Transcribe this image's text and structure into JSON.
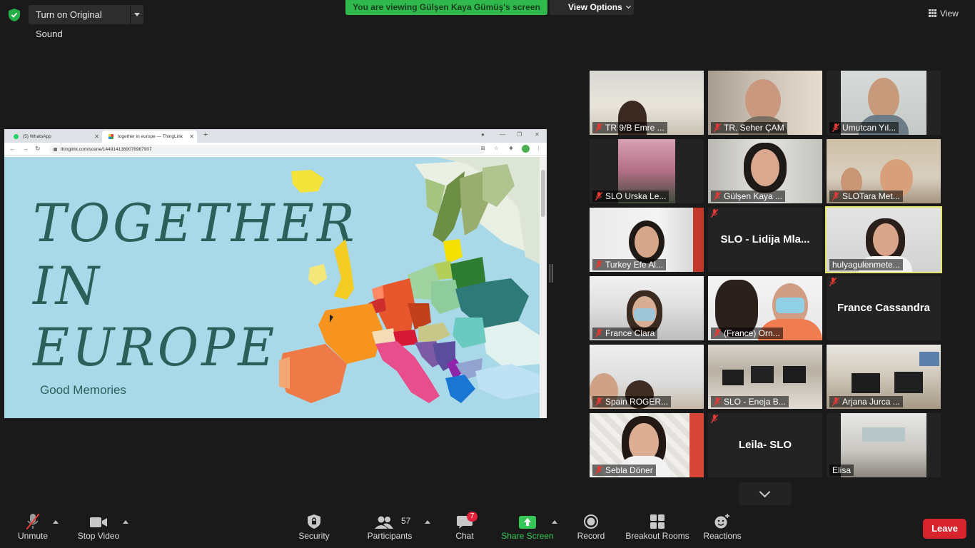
{
  "top": {
    "original_sound_label": "Turn on Original Sound",
    "viewing_banner": "You are viewing Gülşen Kaya Gümüş's screen",
    "view_options_label": "View Options",
    "view_label": "View"
  },
  "shared_screen": {
    "tabs": [
      {
        "label": "(5) WhatsApp"
      },
      {
        "label": "together in europe — ThingLink"
      }
    ],
    "url": "thinglink.com/scene/1449141389076987907",
    "title_lines": [
      "TOGETHER",
      "IN",
      "EUROPE"
    ],
    "subtitle": "Good Memories"
  },
  "participants": [
    {
      "name": "TR 9/B Emre ...",
      "muted": true
    },
    {
      "name": "TR. Seher ÇAM",
      "muted": true
    },
    {
      "name": "Umutcan Yıl...",
      "muted": true
    },
    {
      "name": "SLO Urska Le...",
      "muted": true
    },
    {
      "name": "Gülşen Kaya ...",
      "muted": true
    },
    {
      "name": "SLOTara Met...",
      "muted": true
    },
    {
      "name": "Turkey Efe Al...",
      "muted": true
    },
    {
      "name": "SLO - Lidija Mla...",
      "muted": true
    },
    {
      "name": "hulyagulenmete...",
      "muted": false
    },
    {
      "name": "France Clara",
      "muted": true
    },
    {
      "name": "(France) Orn...",
      "muted": true
    },
    {
      "name": "France Cassandra",
      "muted": true
    },
    {
      "name": "Spain ROGER...",
      "muted": true
    },
    {
      "name": "SLO - Eneja B...",
      "muted": true
    },
    {
      "name": "Arjana Jurca ...",
      "muted": true
    },
    {
      "name": "Sebla Döner",
      "muted": true
    },
    {
      "name": "Leila- SLO",
      "muted": true
    },
    {
      "name": "Elisa",
      "muted": false
    }
  ],
  "toolbar": {
    "unmute": "Unmute",
    "stop_video": "Stop Video",
    "security": "Security",
    "participants": "Participants",
    "participants_count": "57",
    "chat": "Chat",
    "chat_badge": "7",
    "share_screen": "Share Screen",
    "record": "Record",
    "breakout_rooms": "Breakout Rooms",
    "reactions": "Reactions",
    "leave": "Leave"
  },
  "colors": {
    "banner_green": "#2fb84c",
    "leave_red": "#d6232c",
    "active_speaker": "#e6e66a",
    "share_green": "#36c856"
  }
}
